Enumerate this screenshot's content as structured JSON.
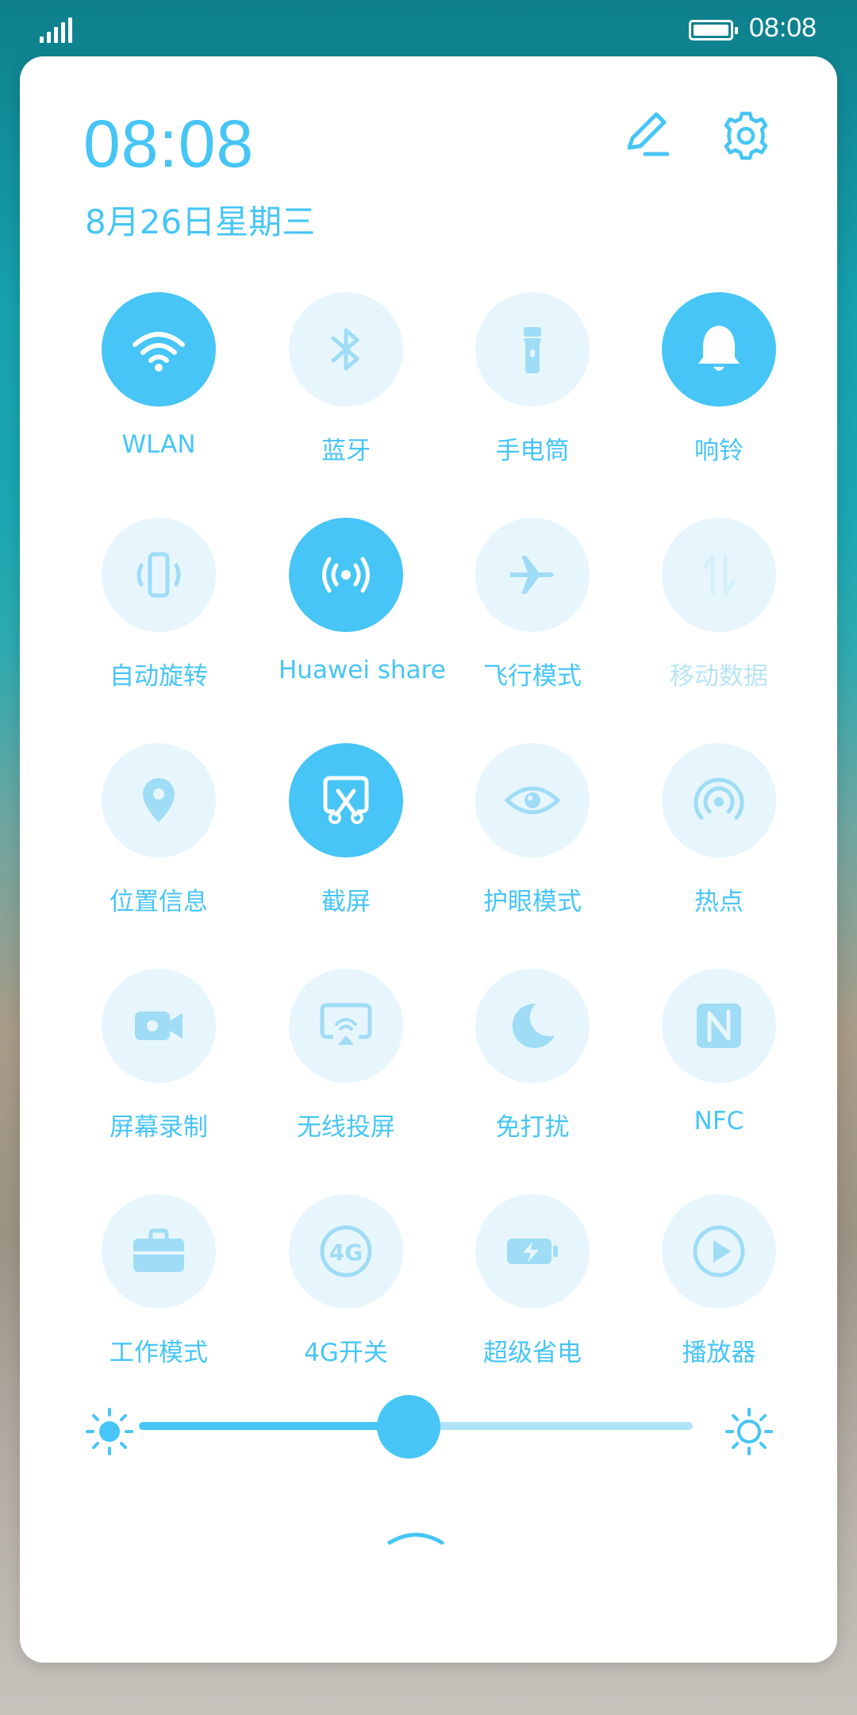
{
  "status_bar": {
    "time": "08:08",
    "signal_icon": "signal-bars-icon",
    "battery_icon": "battery-icon"
  },
  "panel": {
    "clock": "08:08",
    "date": "8月26日星期三",
    "edit_icon": "edit-icon",
    "settings_icon": "gear-icon"
  },
  "tiles": [
    {
      "label": "WLAN",
      "icon": "wifi-icon",
      "active": true
    },
    {
      "label": "蓝牙",
      "icon": "bluetooth-icon",
      "active": false
    },
    {
      "label": "手电筒",
      "icon": "flashlight-icon",
      "active": false
    },
    {
      "label": "响铃",
      "icon": "bell-icon",
      "active": true
    },
    {
      "label": "自动旋转",
      "icon": "rotate-icon",
      "active": false
    },
    {
      "label": "Huawei share",
      "icon": "huawei-share-icon",
      "active": true
    },
    {
      "label": "飞行模式",
      "icon": "airplane-icon",
      "active": false
    },
    {
      "label": "移动数据",
      "icon": "mobile-data-icon",
      "active": false,
      "disabled": true
    },
    {
      "label": "位置信息",
      "icon": "location-icon",
      "active": false
    },
    {
      "label": "截屏",
      "icon": "screenshot-icon",
      "active": true
    },
    {
      "label": "护眼模式",
      "icon": "eye-icon",
      "active": false
    },
    {
      "label": "热点",
      "icon": "hotspot-icon",
      "active": false
    },
    {
      "label": "屏幕录制",
      "icon": "screen-record-icon",
      "active": false
    },
    {
      "label": "无线投屏",
      "icon": "wireless-projection-icon",
      "active": false
    },
    {
      "label": "免打扰",
      "icon": "moon-icon",
      "active": false
    },
    {
      "label": "NFC",
      "icon": "nfc-icon",
      "active": false
    },
    {
      "label": "工作模式",
      "icon": "briefcase-icon",
      "active": false
    },
    {
      "label": "4G开关",
      "icon": "4g-icon",
      "active": false
    },
    {
      "label": "超级省电",
      "icon": "battery-saver-icon",
      "active": false
    },
    {
      "label": "播放器",
      "icon": "play-icon",
      "active": false
    }
  ],
  "brightness": {
    "value": 0.49,
    "low_icon": "brightness-low-icon",
    "high_icon": "brightness-high-icon"
  },
  "colors": {
    "accent": "#46c5f6",
    "tile_off": "#e7f6fd",
    "panel": "#ffffff"
  },
  "collapse_icon": "chevron-up-icon"
}
